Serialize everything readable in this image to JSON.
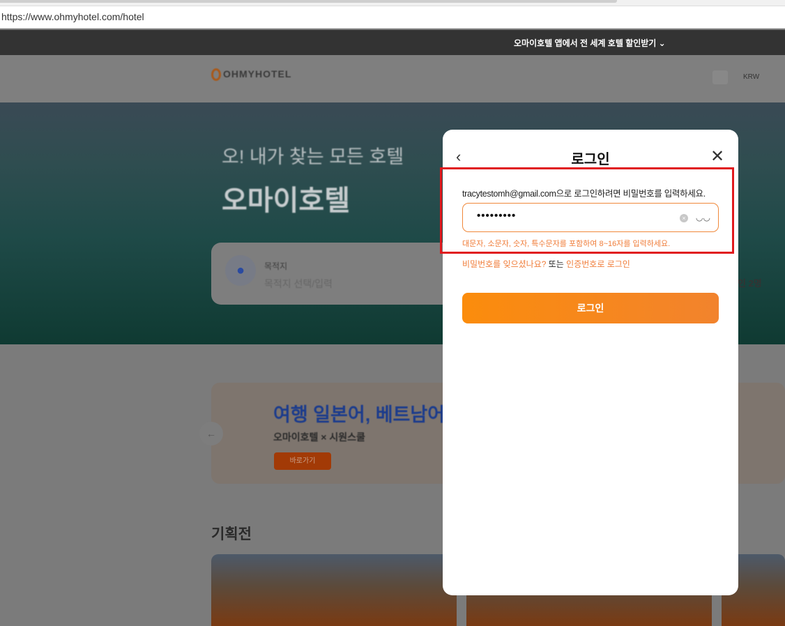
{
  "browser": {
    "url": "https://www.ohmyhotel.com/hotel"
  },
  "promo": {
    "text": "오마이호텔 앱에서 전 세계 호텔 할인받기 ⌄"
  },
  "header": {
    "logo": "OHMYHOTEL",
    "currency": "KRW"
  },
  "hero": {
    "subtitle": "오! 내가 찾는 모든 호텔",
    "title": "오마이호텔"
  },
  "search": {
    "destination_label": "목적지",
    "destination_placeholder": "목적지 선택/입력",
    "guests": "인 2명"
  },
  "banner": {
    "title": "여행 일본어, 베트남어",
    "subtitle": "오마이호텔 × 시원스쿨",
    "button": "바로가기"
  },
  "section": {
    "title": "기획전"
  },
  "modal": {
    "title": "로그인",
    "info": "tracytestomh@gmail.com으로 로그인하려면 비밀번호를 입력하세요.",
    "password_value": "•••••••••",
    "hint": "대문자, 소문자, 숫자, 특수문자를 포함하여 8~16자를 입력하세요.",
    "forgot_link": "비밀번호를 잊으셨나요?",
    "or": " 또는 ",
    "code_login_link": "인증번호로 로그인",
    "login_button": "로그인"
  }
}
